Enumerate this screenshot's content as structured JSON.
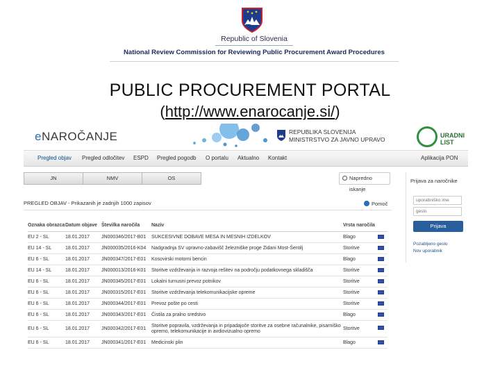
{
  "banner": {
    "country": "Republic of Slovenia",
    "commission": "National Review Commission for Reviewing Public Procurement Award Procedures"
  },
  "slide": {
    "title": "PUBLIC PROCUREMENT PORTAL",
    "url_open": "(",
    "url": "http://www.enarocanje.si/",
    "url_close": ")"
  },
  "site": {
    "logo_e": "e",
    "logo_rest": "NAROČANJE",
    "gov_line1": "REPUBLIKA SLOVENIJA",
    "gov_line2": "MINISTRSTVO ZA JAVNO UPRAVO",
    "ul_text": "URADNI LIST",
    "nav": [
      "Pregled objav",
      "Pregled odločitev",
      "ESPD",
      "Pregled pogodb",
      "O portalu",
      "Aktualno",
      "Kontakt"
    ],
    "nav_right": "Aplikacija PON",
    "subtabs": [
      "JN",
      "NMV",
      "OS"
    ],
    "search_label": "Napredno iskanje",
    "panel_head": "PREGLED OBJAV - Prikazanih je zadnjih 1000 zapisov",
    "help": "Pomoč",
    "columns": [
      "Oznaka obrazca",
      "Datum objave",
      "Številka naročila",
      "Naziv",
      "Vrsta naročila",
      ""
    ],
    "rows": [
      {
        "form": "EU 2 - SL",
        "date": "18.01.2017",
        "number": "JN000346/2017-B01",
        "title": "SUKCESIVNE DOBAVE MESA IN MESNIH IZDELKOV",
        "type": "Blago"
      },
      {
        "form": "EU 14 - SL",
        "date": "18.01.2017",
        "number": "JN000035/2016-K04",
        "title": "Nadgradnja SV upravno-zabavišč železniške proge Zidani Most-Šentilj",
        "type": "Storitve"
      },
      {
        "form": "EU 6 - SL",
        "date": "18.01.2017",
        "number": "JN000347/2017-E01",
        "title": "Kosovirski motorni bencin",
        "type": "Blago"
      },
      {
        "form": "EU 14 - SL",
        "date": "18.01.2017",
        "number": "JN000013/2016-K01",
        "title": "Storitve vzdrževanja in razvoja rešitev na področju podatkovnega skladišča",
        "type": "Storitve"
      },
      {
        "form": "EU 6 - SL",
        "date": "18.01.2017",
        "number": "JN000345/2017-E01",
        "title": "Lokalni turnusni prevoz potnikov",
        "type": "Storitve"
      },
      {
        "form": "EU 6 - SL",
        "date": "18.01.2017",
        "number": "JN000315/2017-E01",
        "title": "Storitve vzdrževanja telekomunikacijske opreme",
        "type": "Storitve"
      },
      {
        "form": "EU 6 - SL",
        "date": "18.01.2017",
        "number": "JN000344/2017-E01",
        "title": "Prevoz pošte po cesti",
        "type": "Storitve"
      },
      {
        "form": "EU 6 - SL",
        "date": "18.01.2017",
        "number": "JN000343/2017-E01",
        "title": "Čistila za pralno sredstvo",
        "type": "Blago"
      },
      {
        "form": "EU 6 - SL",
        "date": "18.01.2017",
        "number": "JN000342/2017-E01",
        "title": "Storitve popravila, vzdrževanja in pripadajoče storitve za osebne računalnike, pisarniško opremo, telekomunikacije in avdiovizualno opremo",
        "type": "Storitve",
        "tall": true
      },
      {
        "form": "EU 6 - SL",
        "date": "18.01.2017",
        "number": "JN000341/2017-E01",
        "title": "Medicinski plin",
        "type": "Blago"
      }
    ],
    "side": {
      "title": "Prijava za naročnike",
      "user_placeholder": "uporabniško ime",
      "pass_placeholder": "geslo",
      "login": "Prijava",
      "forgot": "Pozabljeno geslo",
      "new_user": "Nov uporabnik"
    }
  },
  "colors": {
    "brand_blue": "#2a5f9e",
    "flag_blue": "#2f4fa8",
    "ul_green": "#2f8f3e"
  }
}
